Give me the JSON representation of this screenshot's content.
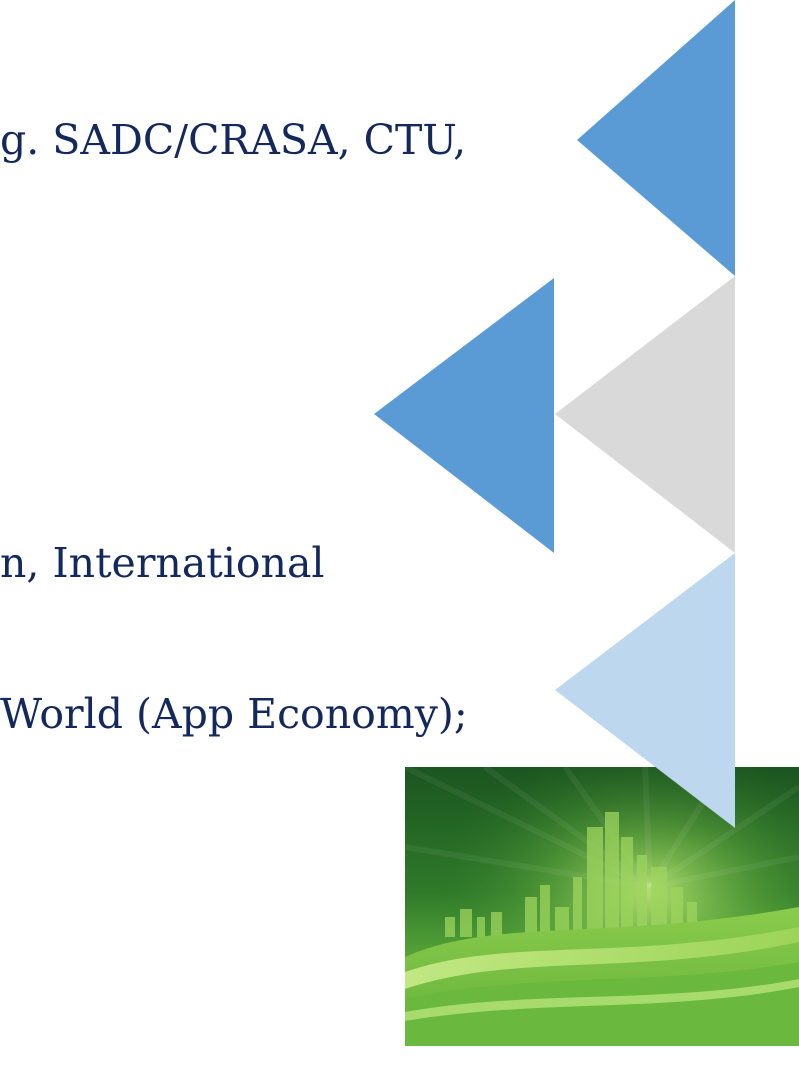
{
  "slide": {
    "lines": [
      "g. SADC/CRASA, CTU,",
      "n, International",
      "World (App Economy);"
    ]
  },
  "colors": {
    "text": "#13295e",
    "triangle_blue": "#5b9bd5",
    "triangle_grey": "#d9d9d9",
    "triangle_light_blue": "#bdd7ee",
    "banner_dark_green": "#1e5a22",
    "banner_light_green": "#8fd14f"
  }
}
